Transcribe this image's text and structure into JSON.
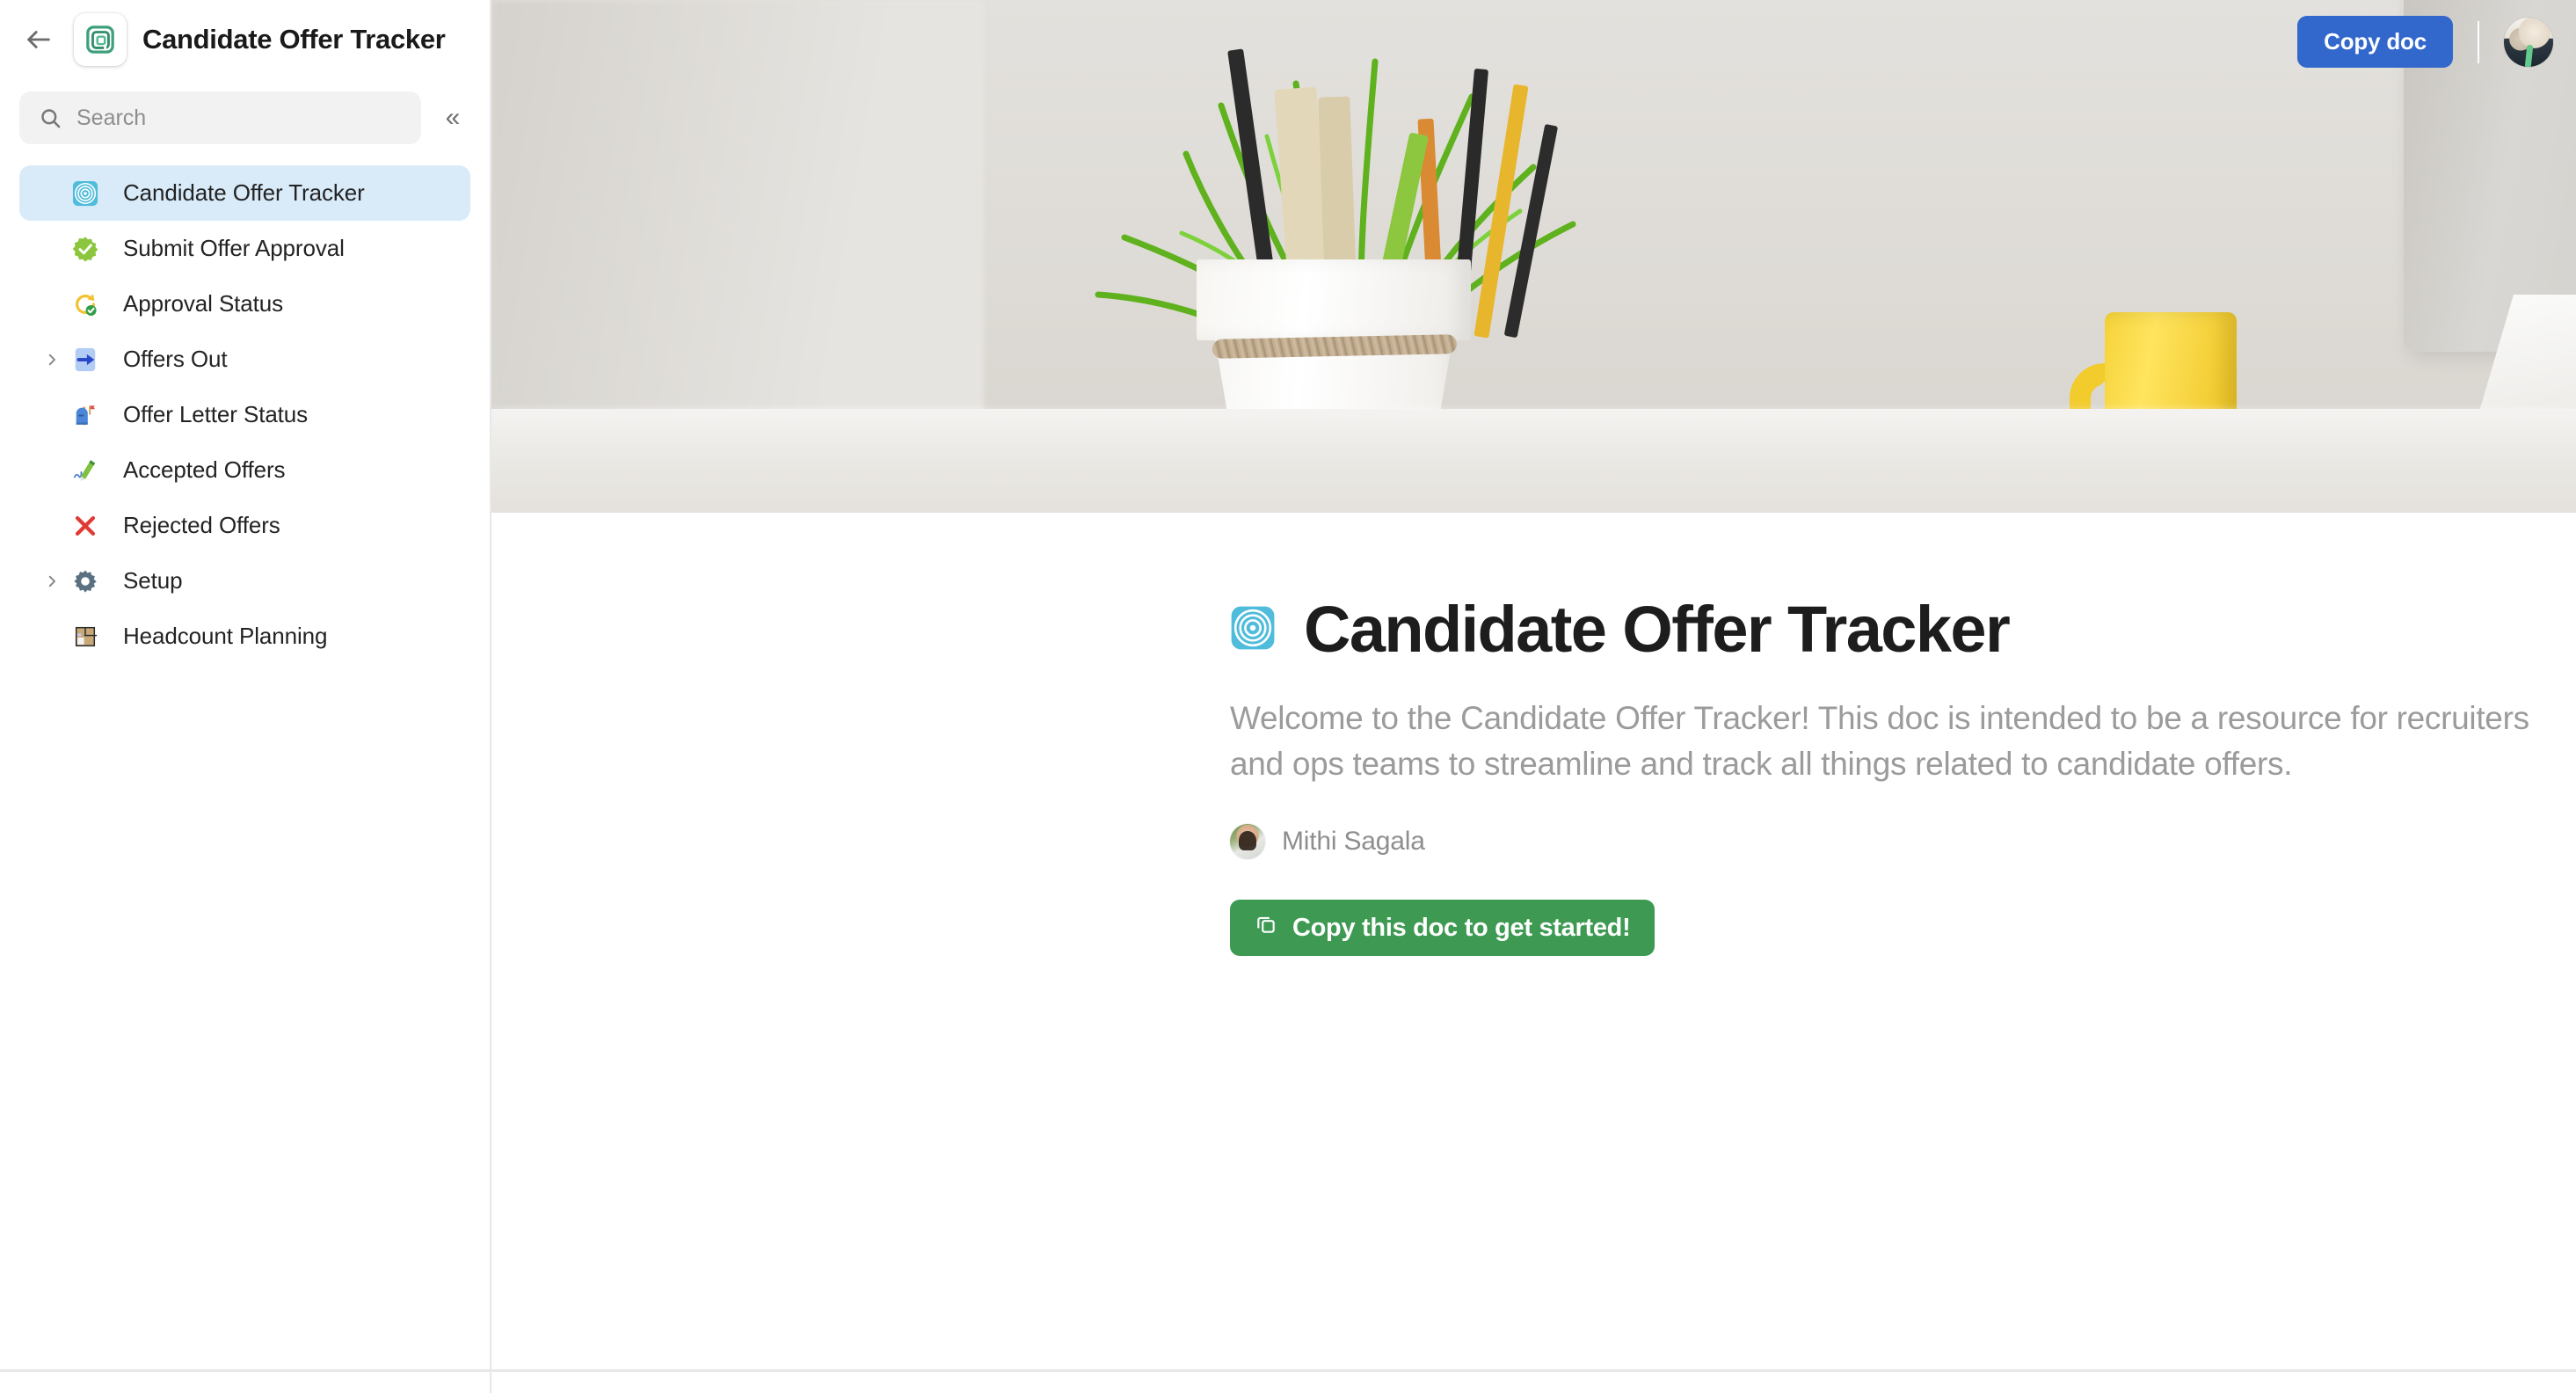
{
  "sidebar": {
    "back_label": "back-arrow",
    "doc_icon": "green-square-spiral-icon",
    "title": "Candidate Offer Tracker",
    "search": {
      "placeholder": "Search",
      "value": "",
      "icon": "search-icon"
    },
    "collapse_icon": "«",
    "items": [
      {
        "label": "Candidate Offer Tracker",
        "icon": "target-rings-icon",
        "selected": true,
        "expandable": false
      },
      {
        "label": "Submit Offer Approval",
        "icon": "green-check-badge-icon",
        "selected": false,
        "expandable": false
      },
      {
        "label": "Approval Status",
        "icon": "arrow-refresh-check-icon",
        "selected": false,
        "expandable": false
      },
      {
        "label": "Offers Out",
        "icon": "blue-arrow-right-icon",
        "selected": false,
        "expandable": true
      },
      {
        "label": "Offer Letter Status",
        "icon": "mailbox-icon",
        "selected": false,
        "expandable": false
      },
      {
        "label": "Accepted Offers",
        "icon": "signature-pen-icon",
        "selected": false,
        "expandable": false
      },
      {
        "label": "Rejected Offers",
        "icon": "red-x-icon",
        "selected": false,
        "expandable": false
      },
      {
        "label": "Setup",
        "icon": "gear-icon",
        "selected": false,
        "expandable": true
      },
      {
        "label": "Headcount Planning",
        "icon": "floor-plan-icon",
        "selected": false,
        "expandable": false
      }
    ]
  },
  "banner": {
    "alt": "desk-photo-with-plant-pot-pencils-yellow-mug-and-monitor",
    "copy_doc_label": "Copy doc",
    "avatar_name": "user-avatar"
  },
  "doc": {
    "icon": "target-rings-icon",
    "title": "Candidate Offer Tracker",
    "description": "Welcome to the Candidate Offer Tracker! This doc is intended to be a resource for recruiters and ops teams to streamline and track all things related to candidate offers.",
    "author": "Mithi Sagala",
    "cta_label": "Copy this doc to get started!",
    "cta_icon": "copy-icon"
  },
  "colors": {
    "accent_blue": "#3267cc",
    "accent_green": "#3e9a52",
    "selected_item_bg": "#d9ebf9",
    "text_primary": "#1d1d1d",
    "text_muted": "#9b9b9b"
  }
}
